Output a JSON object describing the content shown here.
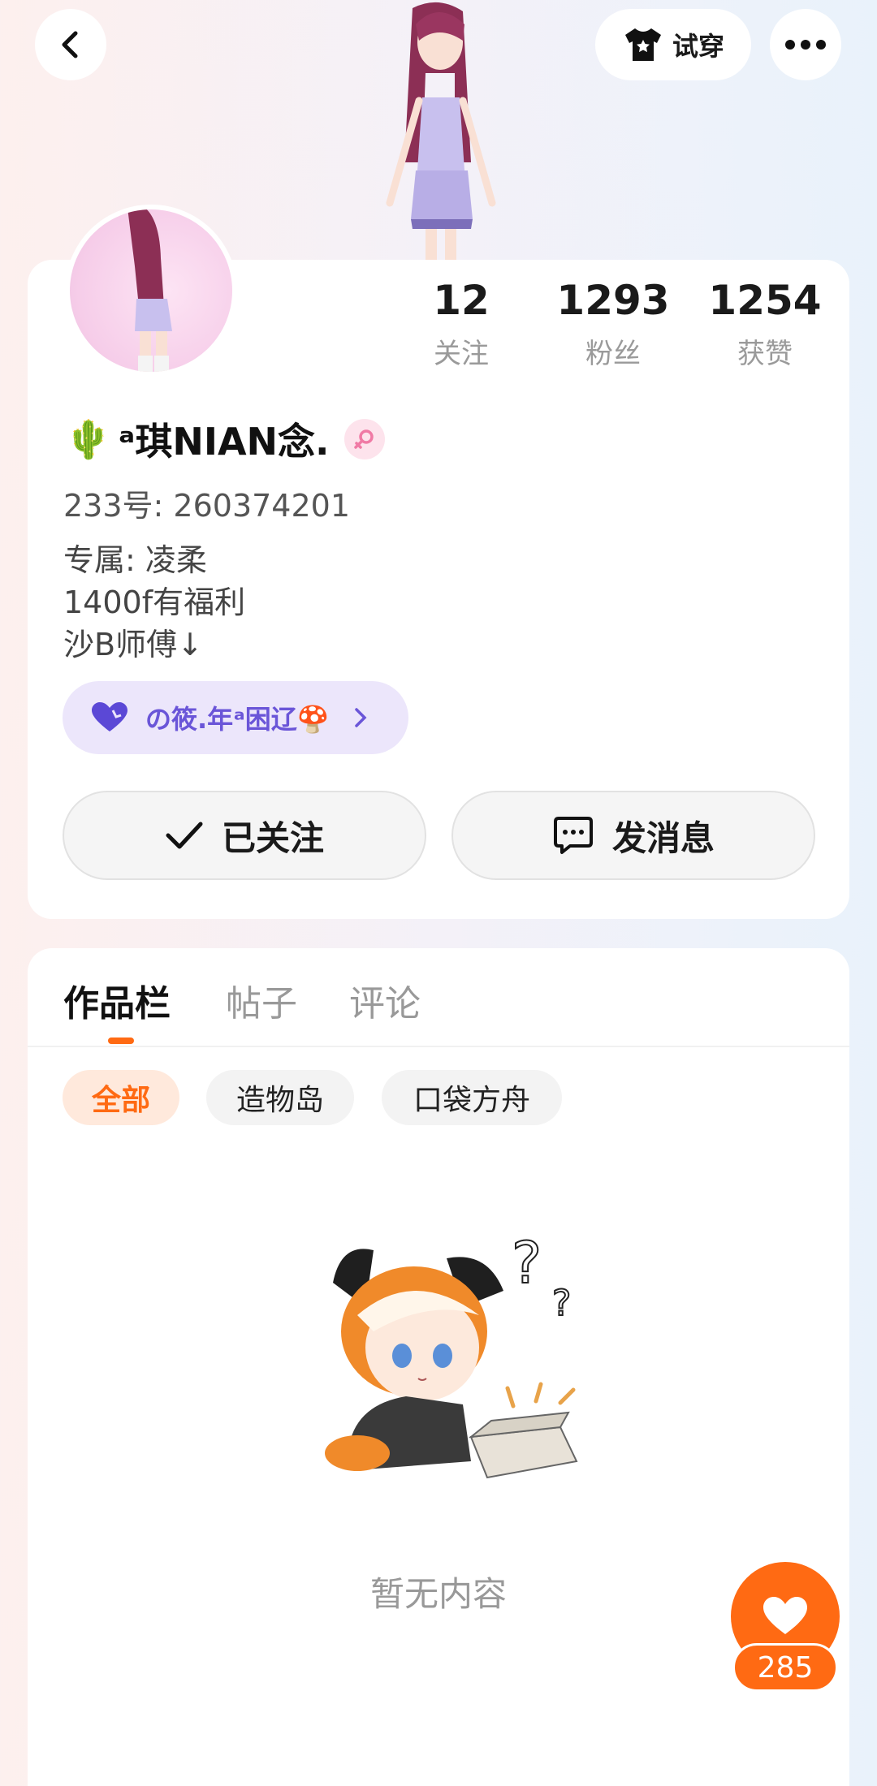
{
  "header": {
    "try_on_label": "试穿",
    "icons": {
      "back": "chevron-left-icon",
      "try_on": "shirt-icon",
      "more": "more-dots-icon"
    }
  },
  "profile": {
    "name_emoji": "🌵",
    "name": "ᵃ琪NIAN念.",
    "uid": "233号: 260374201",
    "bio": [
      "专属: 凌柔",
      "1400f有福利",
      "沙B师傅↓"
    ],
    "guild": {
      "text": "の筱.年ᵃ困辽🍄",
      "icon": "heart-icon"
    },
    "stats": [
      {
        "value": "12",
        "label": "关注"
      },
      {
        "value": "1293",
        "label": "粉丝"
      },
      {
        "value": "1254",
        "label": "获赞"
      }
    ],
    "follow_label": "已关注",
    "message_label": "发消息"
  },
  "works": {
    "tabs": [
      "作品栏",
      "帖子",
      "评论"
    ],
    "active_tab": "作品栏",
    "chips": [
      "全部",
      "造物岛",
      "口袋方舟"
    ],
    "active_chip": "全部",
    "empty_text": "暂无内容"
  },
  "like": {
    "count": "285"
  },
  "colors": {
    "accent": "#ff6a13",
    "guild_bg": "#ece6fb",
    "guild_text": "#6a55d8"
  }
}
